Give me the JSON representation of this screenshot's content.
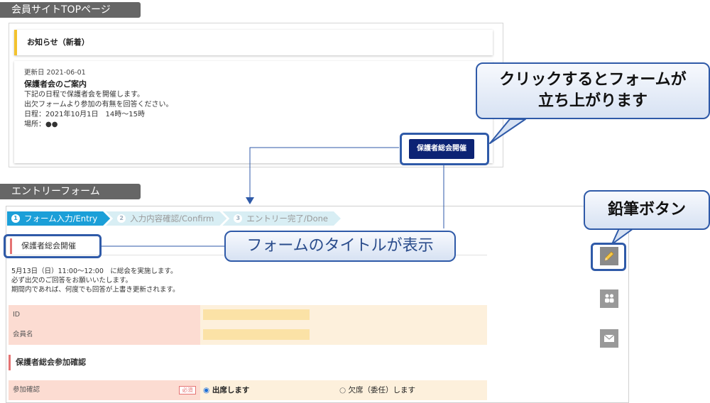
{
  "labels": {
    "top_section": "会員サイトTOPページ",
    "form_section": "エントリーフォーム"
  },
  "notice": {
    "header": "お知らせ（新着）",
    "date": "更新日 2021-06-01",
    "title": "保護者会のご案内",
    "lines": [
      "下記の日程で保護者会を開催します。",
      "出欠フォームより参加の有無を回答ください。",
      "日程：2021年10月1日　14時〜15時",
      "場所：●●"
    ],
    "button_label": "保護者総会開催"
  },
  "callouts": {
    "click": "クリックするとフォームが\n立ち上がります",
    "pencil": "鉛筆ボタン",
    "title": "フォームのタイトルが表示"
  },
  "form": {
    "steps": [
      {
        "num": "1",
        "label": "フォーム入力/Entry",
        "active": true
      },
      {
        "num": "2",
        "label": "入力内容確認/Confirm",
        "active": false
      },
      {
        "num": "3",
        "label": "エントリー完了/Done",
        "active": false
      }
    ],
    "title": "保護者総会開催",
    "intro": [
      "5月13日（日）11:00〜12:00　に総会を実施します。",
      "必ず出欠のご回答をお願いいたします。",
      "期間内であれば、何度でも回答が上書き更新されます。"
    ],
    "fields": [
      {
        "label": "ID",
        "value": ""
      },
      {
        "label": "会員名",
        "value": ""
      }
    ],
    "section_title": "保護者総会参加確認",
    "attendance": {
      "label": "参加確認",
      "required": "必須",
      "options": [
        "出席します",
        "欠席（委任）します"
      ],
      "selected": "出席します"
    }
  },
  "side_icons": [
    "pencil-icon",
    "people-icon",
    "mail-icon"
  ]
}
